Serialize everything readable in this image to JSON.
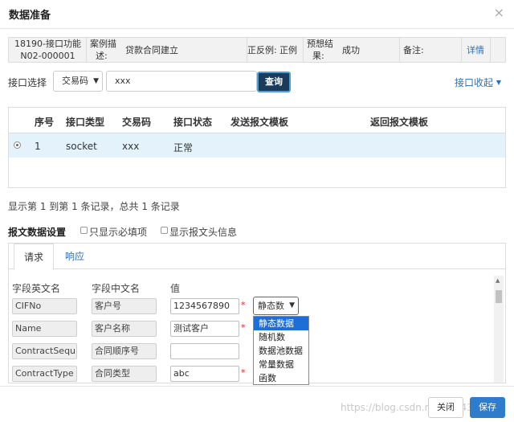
{
  "dialog": {
    "title": "数据准备",
    "close_glyph": "×"
  },
  "case": {
    "id_line1": "18190-接口功能",
    "id_line2": "N02-000001",
    "desc_label_1": "案例描",
    "desc_label_2": "述:",
    "desc_value": "贷款合同建立",
    "posneg_label": "正反例:",
    "posneg_value": "正例",
    "expect_label_1": "预想结",
    "expect_label_2": "果:",
    "expect_value": "成功",
    "remark_label": "备注:",
    "remark_value": "",
    "detail_link": "详情"
  },
  "search": {
    "label": "接口选择",
    "select_value": "交易码",
    "input_value": "xxx",
    "query_button": "查询",
    "collapse_link": "接口收起",
    "collapse_caret": "▼"
  },
  "grid": {
    "headers": [
      "序号",
      "接口类型",
      "交易码",
      "接口状态",
      "发送报文模板",
      "返回报文模板"
    ],
    "rows": [
      {
        "index": "1",
        "type": "socket",
        "code": "xxx",
        "status": "正常",
        "send_tpl": "",
        "return_tpl": ""
      }
    ]
  },
  "summary": "显示第 1 到第 1 条记录，总共 1 条记录",
  "settings": {
    "title": "报文数据设置",
    "only_required": "只显示必填项",
    "show_header": "显示报文头信息"
  },
  "tabs": {
    "request": "请求",
    "response": "响应"
  },
  "fields": {
    "headers": {
      "en": "字段英文名",
      "cn": "字段中文名",
      "value": "值"
    },
    "rows": [
      {
        "en": "CIFNo",
        "cn": "客户号",
        "value": "1234567890",
        "required": "*"
      },
      {
        "en": "Name",
        "cn": "客户名称",
        "value": "测试客户",
        "required": "*"
      },
      {
        "en": "ContractSequ",
        "cn": "合同顺序号",
        "value": "",
        "required": ""
      },
      {
        "en": "ContractType",
        "cn": "合同类型",
        "value": "abc",
        "required": "*"
      }
    ]
  },
  "source_dropdown": {
    "selected": "静态数",
    "options": [
      "静态数据",
      "随机数",
      "数据池数据",
      "常量数据",
      "函数"
    ],
    "highlighted": 0
  },
  "footer": {
    "watermark": "https://blog.csdn.net/qq_43xxx",
    "close_button": "关闭",
    "save_button": "保存"
  }
}
